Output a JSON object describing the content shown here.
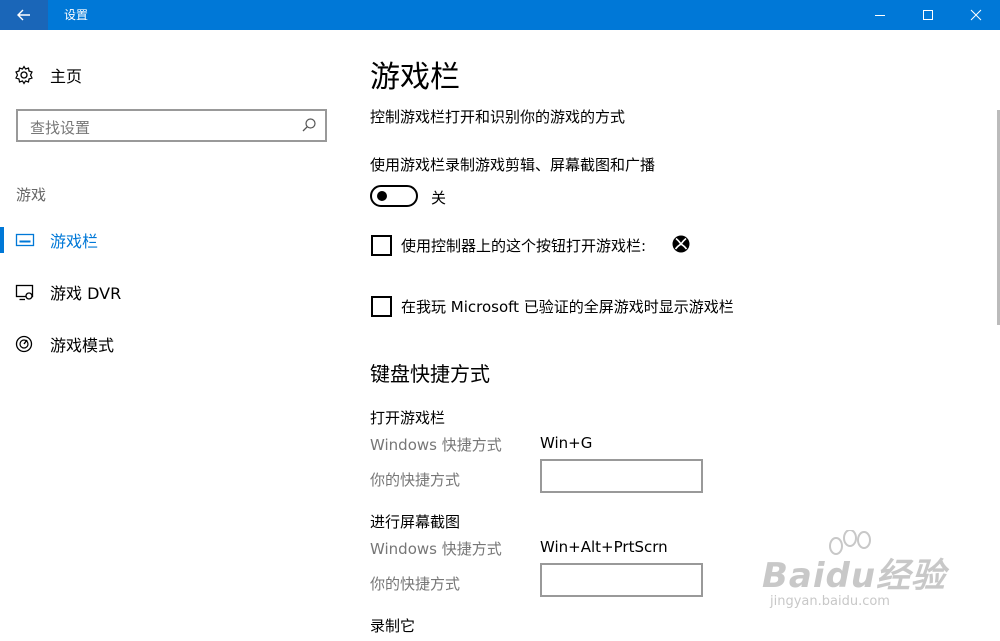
{
  "window": {
    "title": "设置",
    "colors": {
      "titlebar": "#0078d7",
      "accent": "#0078d7"
    }
  },
  "sidebar": {
    "home_label": "主页",
    "search_placeholder": "查找设置",
    "section_label": "游戏",
    "items": [
      {
        "label": "游戏栏",
        "icon": "gamebar-icon",
        "active": true
      },
      {
        "label": "游戏 DVR",
        "icon": "dvr-icon",
        "active": false
      },
      {
        "label": "游戏模式",
        "icon": "gamemode-icon",
        "active": false
      }
    ]
  },
  "main": {
    "title": "游戏栏",
    "description": "控制游戏栏打开和识别你的游戏的方式",
    "record_label": "使用游戏栏录制游戏剪辑、屏幕截图和广播",
    "toggle_state": "关",
    "checkbox_controller": "使用控制器上的这个按钮打开游戏栏:",
    "checkbox_fullscreen": "在我玩 Microsoft 已验证的全屏游戏时显示游戏栏",
    "keyboard_section": "键盘快捷方式",
    "groups": [
      {
        "title": "打开游戏栏",
        "windows_key_label": "Windows 快捷方式",
        "windows_key_value": "Win+G",
        "custom_label": "你的快捷方式",
        "custom_value": ""
      },
      {
        "title": "进行屏幕截图",
        "windows_key_label": "Windows 快捷方式",
        "windows_key_value": "Win+Alt+PrtScrn",
        "custom_label": "你的快捷方式",
        "custom_value": ""
      },
      {
        "title": "录制它"
      }
    ]
  },
  "watermark": {
    "main": "Baidu经验",
    "sub": "jingyan.baidu.com"
  }
}
